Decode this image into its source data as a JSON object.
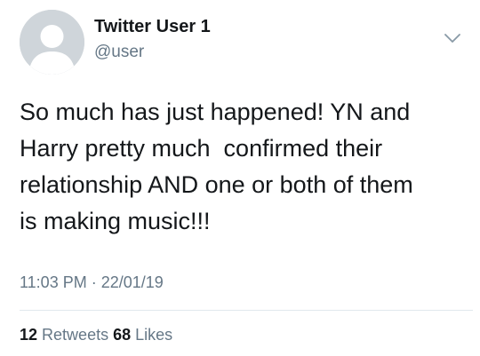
{
  "tweet": {
    "display_name": "Twitter User 1",
    "handle": "@user",
    "text": "So much has just happened! YN and\nHarry pretty much  confirmed their\nrelationship AND one or both of them\nis making music!!!",
    "time": "11:03 PM",
    "separator": "·",
    "date": "22/01/19",
    "retweets_count": "12",
    "retweets_label": "Retweets",
    "likes_count": "68",
    "likes_label": "Likes",
    "icons": {
      "avatar": "default-avatar-silhouette",
      "menu": "chevron-down-icon"
    },
    "colors": {
      "text": "#14171a",
      "secondary": "#657786",
      "avatar_bg": "#cfd5da",
      "divider": "#e1e8ed"
    }
  }
}
